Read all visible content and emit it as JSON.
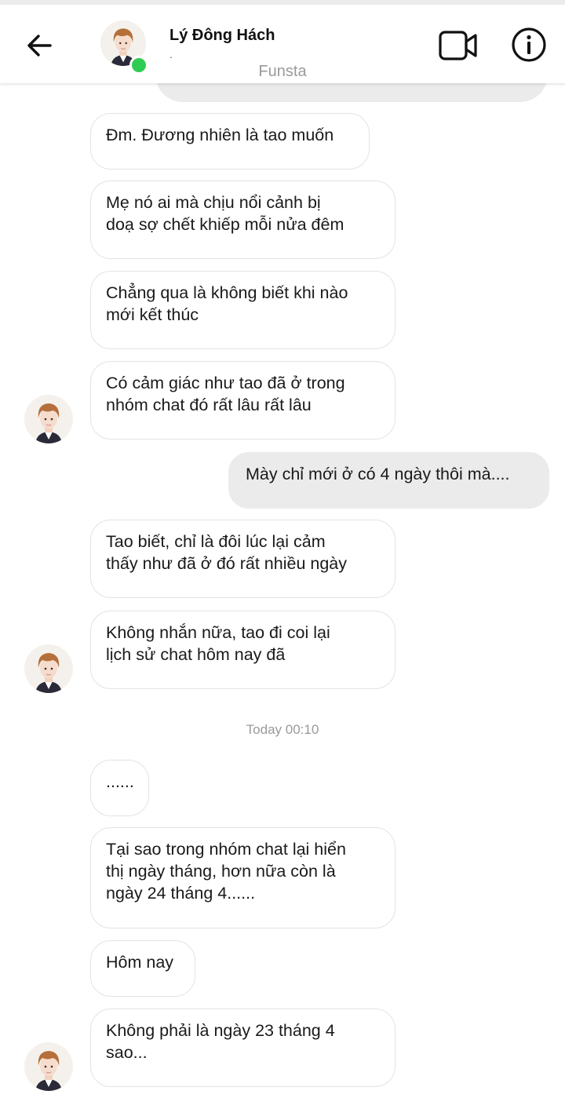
{
  "header": {
    "contact_name": "Lý Đông Hách",
    "status_dot": ".",
    "watermark": "Funsta",
    "icons": {
      "back": "back-arrow-icon",
      "video": "video-call-icon",
      "info": "info-icon"
    },
    "online_color": "#2ecc52"
  },
  "messages": [
    {
      "text": "Đm. Đương nhiên là tao muốn",
      "sender": "contact"
    },
    {
      "text": "Mẹ nó ai mà chịu nổi cảnh bị\ndoạ sợ chết khiếp mỗi nửa đêm",
      "sender": "contact"
    },
    {
      "text": "Chẳng qua là không biết khi nào\nmới kết thúc",
      "sender": "contact"
    },
    {
      "text": "Có cảm giác như tao đã ở trong\nnhóm chat đó rất lâu rất lâu",
      "sender": "contact"
    },
    {
      "text": "Mày chỉ mới ở có 4 ngày thôi mà....",
      "sender": "me"
    },
    {
      "text": "Tao biết, chỉ là đôi lúc lại cảm\nthấy như đã ở đó rất nhiều ngày",
      "sender": "contact"
    },
    {
      "text": "Không nhắn nữa, tao đi coi lại\nlịch sử chat hôm nay đã",
      "sender": "contact"
    },
    {
      "text": "......",
      "sender": "contact"
    },
    {
      "text": "Tại sao trong nhóm chat lại hiển\nthị ngày tháng, hơn nữa còn là\nngày 24 tháng 4......",
      "sender": "contact"
    },
    {
      "text": "Hôm nay",
      "sender": "contact"
    },
    {
      "text": "Không phải là ngày 23 tháng 4\nsao...",
      "sender": "contact"
    }
  ],
  "timestamp": "Today 00:10",
  "colors": {
    "my_bubble": "#ebebeb",
    "their_bubble_border": "#e3e3e3"
  }
}
